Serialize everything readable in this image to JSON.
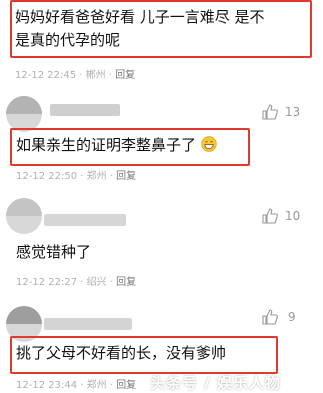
{
  "comments": [
    {
      "text": "妈妈好看爸爸好看 儿子一言难尽 是不是真的代孕的呢",
      "time": "12-12 22:45",
      "location": "郴州",
      "reply": "回复"
    },
    {
      "like_count": "13",
      "text": "如果亲生的证明李整鼻子了了",
      "time": "12-12 22:50",
      "location": "郑州",
      "reply": "回复"
    },
    {
      "like_count": "10",
      "text": "感觉错种了",
      "time": "12-12 22:27",
      "location": "绍兴",
      "reply": "回复"
    },
    {
      "like_count": "9",
      "text": "挑了父母不好看的长，没有爹帅",
      "time": "12-12 23:44",
      "location": "郑州",
      "reply": "回复"
    }
  ],
  "icons": {
    "like": "thumbs-up-icon",
    "emoji": "grinning-face-icon"
  },
  "colors": {
    "highlight": "#e03a2f",
    "meta": "#b0b0b0"
  }
}
